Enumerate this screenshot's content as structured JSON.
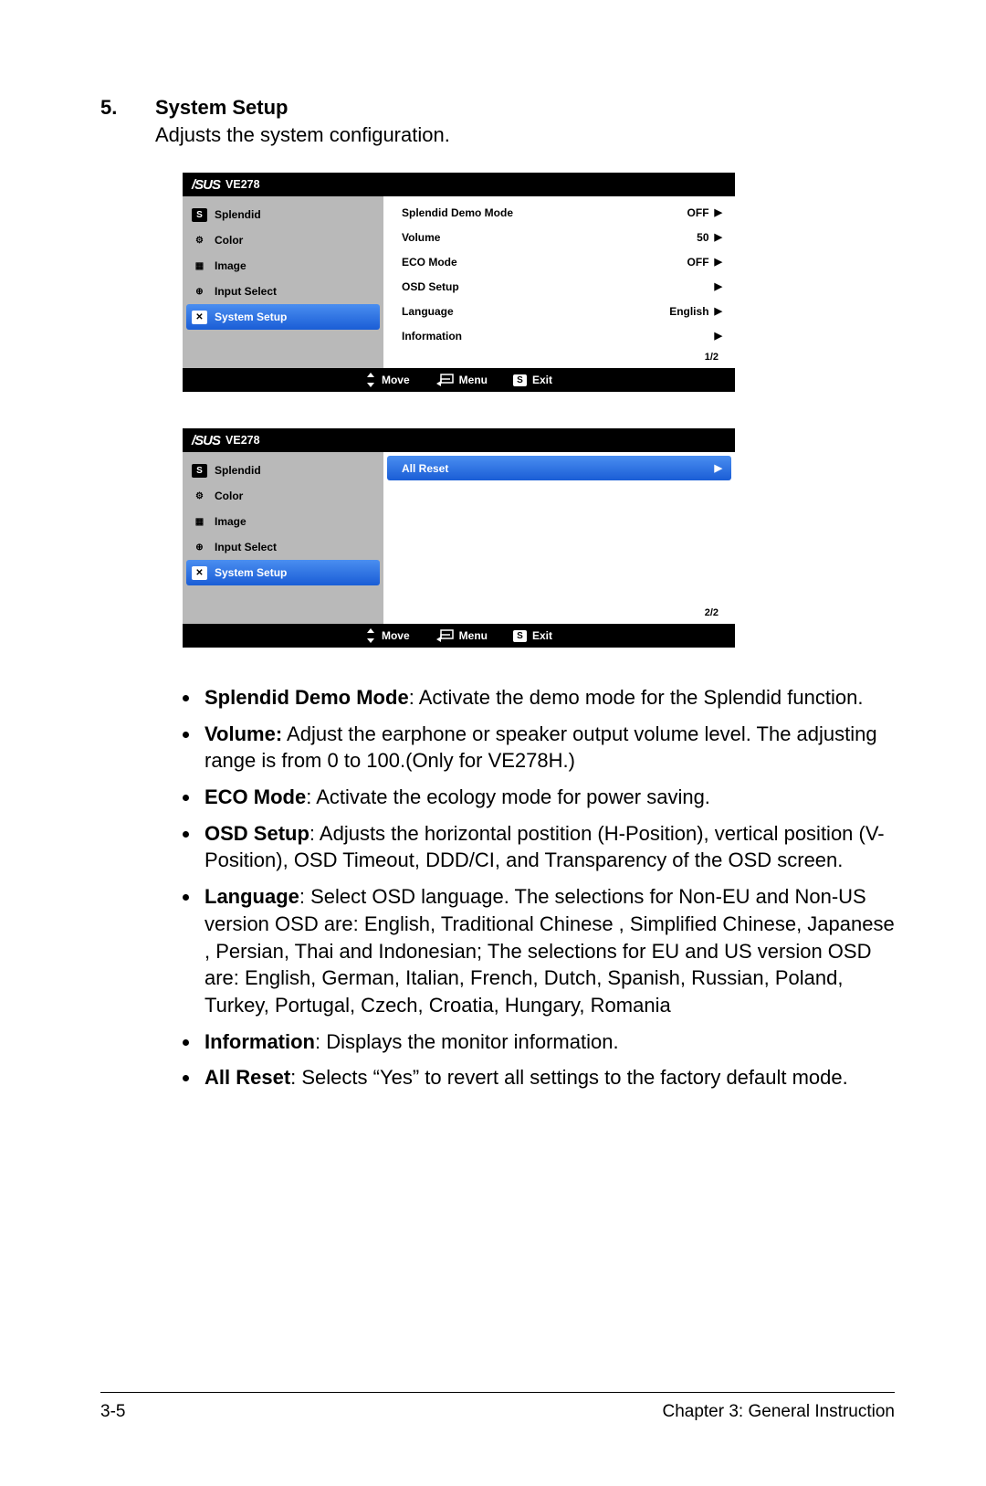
{
  "section": {
    "num": "5.",
    "title": "System Setup",
    "desc": "Adjusts the system configuration."
  },
  "osd_common": {
    "brand": "/SUS",
    "model": "VE278",
    "left_items": [
      {
        "label": "Splendid",
        "icon": "S"
      },
      {
        "label": "Color",
        "icon": "⚙"
      },
      {
        "label": "Image",
        "icon": "▦"
      },
      {
        "label": "Input Select",
        "icon": "⊕"
      },
      {
        "label": "System Setup",
        "icon": "✕",
        "selected": true
      }
    ],
    "footer": {
      "move": "Move",
      "menu": "Menu",
      "exit": "Exit"
    }
  },
  "osd1": {
    "right_items": [
      {
        "label": "Splendid Demo Mode",
        "value": "OFF"
      },
      {
        "label": "Volume",
        "value": "50"
      },
      {
        "label": "ECO Mode",
        "value": "OFF"
      },
      {
        "label": "OSD Setup",
        "value": ""
      },
      {
        "label": "Language",
        "value": "English"
      },
      {
        "label": "Information",
        "value": ""
      }
    ],
    "page": "1/2"
  },
  "osd2": {
    "right_items": [
      {
        "label": "All Reset",
        "value": "",
        "selected": true
      }
    ],
    "page": "2/2"
  },
  "bullets": [
    {
      "bold": "Splendid Demo Mode",
      "text": ": Activate the demo mode for the Splendid function."
    },
    {
      "bold": "Volume:",
      "text": " Adjust the earphone or speaker output volume level. The adjusting range is from 0 to 100.(Only for VE278H.)"
    },
    {
      "bold": "ECO Mode",
      "text": ": Activate the ecology mode for power saving."
    },
    {
      "bold": "OSD Setup",
      "text": ": Adjusts the horizontal postition (H-Position), vertical position (V-Position), OSD Timeout, DDD/CI, and Transparency of the OSD screen."
    },
    {
      "bold": "Language",
      "text": ": Select OSD language. The selections for Non-EU and Non-US version OSD are: English, Traditional Chinese , Simplified Chinese, Japanese , Persian, Thai and Indonesian; The selections for EU and US version OSD are: English, German, Italian, French, Dutch, Spanish, Russian, Poland, Turkey, Portugal, Czech, Croatia, Hungary, Romania"
    },
    {
      "bold": "Information",
      "text": ": Displays the monitor information."
    },
    {
      "bold": "All Reset",
      "text": ": Selects “Yes” to revert all settings to the factory default mode."
    }
  ],
  "footer": {
    "left": "3-5",
    "right": "Chapter 3: General Instruction"
  }
}
